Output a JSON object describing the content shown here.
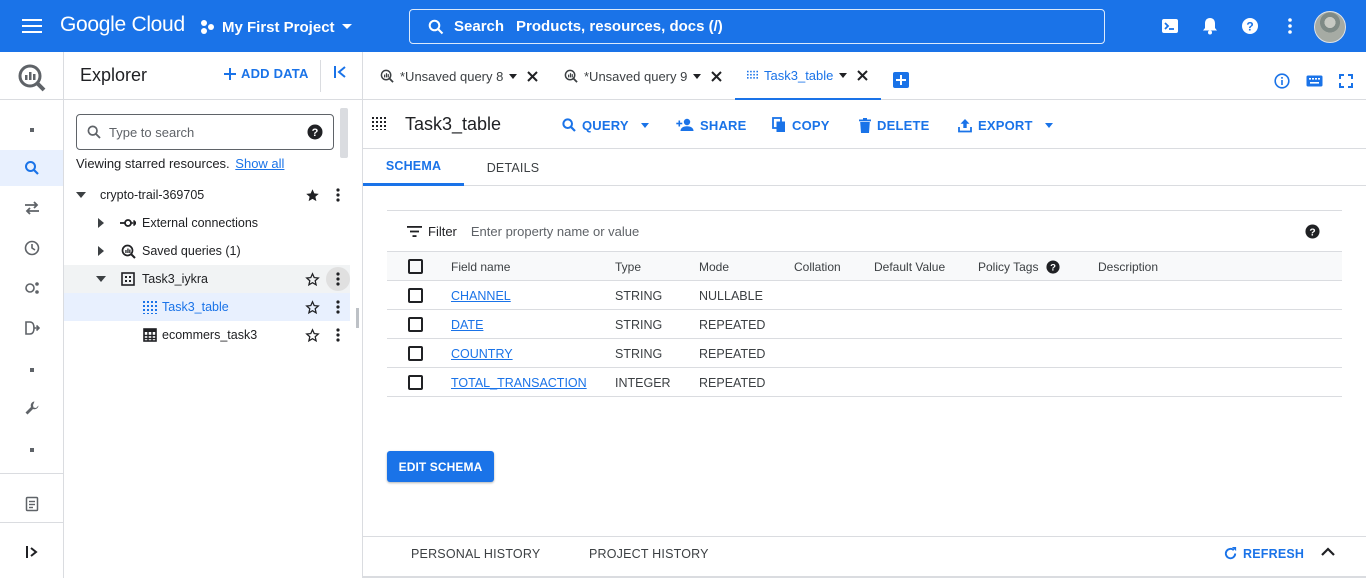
{
  "header": {
    "menu_icon": "hamburger-menu-icon",
    "logo": "Google Cloud",
    "project": "My First Project",
    "search_label": "Search",
    "search_placeholder": "Products, resources, docs (/)",
    "accent": "#1a73e8"
  },
  "rail": {
    "icons": [
      "bigquery-logo-icon",
      "search-icon",
      "transfers-icon",
      "scheduled-queries-icon",
      "analytics-hub-icon",
      "dataform-icon",
      "wrench-icon",
      "notes-icon",
      "expand-icon"
    ]
  },
  "explorer": {
    "title": "Explorer",
    "add_data": "ADD DATA",
    "search_placeholder": "Type to search",
    "starred_text": "Viewing starred resources.",
    "show_all": "Show all",
    "tree": {
      "project": "crypto-trail-369705",
      "external": "External connections",
      "saved": "Saved queries (1)",
      "dataset": "Task3_iykra",
      "table1": "Task3_table",
      "table2": "ecommers_task3"
    }
  },
  "tabs": {
    "t1": "*Unsaved query 8",
    "t2": "*Unsaved query 9",
    "t3": "Task3_table"
  },
  "toolbar": {
    "table_name": "Task3_table",
    "query": "QUERY",
    "share": "SHARE",
    "copy": "COPY",
    "delete": "DELETE",
    "export": "EXPORT"
  },
  "subtabs": {
    "schema": "SCHEMA",
    "details": "DETAILS"
  },
  "filter": {
    "label": "Filter",
    "placeholder": "Enter property name or value"
  },
  "schema": {
    "columns": {
      "field": "Field name",
      "type": "Type",
      "mode": "Mode",
      "collation": "Collation",
      "default": "Default Value",
      "policy": "Policy Tags",
      "description": "Description"
    },
    "rows": [
      {
        "field": "CHANNEL",
        "type": "STRING",
        "mode": "NULLABLE"
      },
      {
        "field": "DATE",
        "type": "STRING",
        "mode": "REPEATED"
      },
      {
        "field": "COUNTRY",
        "type": "STRING",
        "mode": "REPEATED"
      },
      {
        "field": "TOTAL_TRANSACTION",
        "type": "INTEGER",
        "mode": "REPEATED"
      }
    ]
  },
  "edit_schema": "EDIT SCHEMA",
  "history": {
    "personal": "PERSONAL HISTORY",
    "project": "PROJECT HISTORY",
    "refresh": "REFRESH"
  }
}
